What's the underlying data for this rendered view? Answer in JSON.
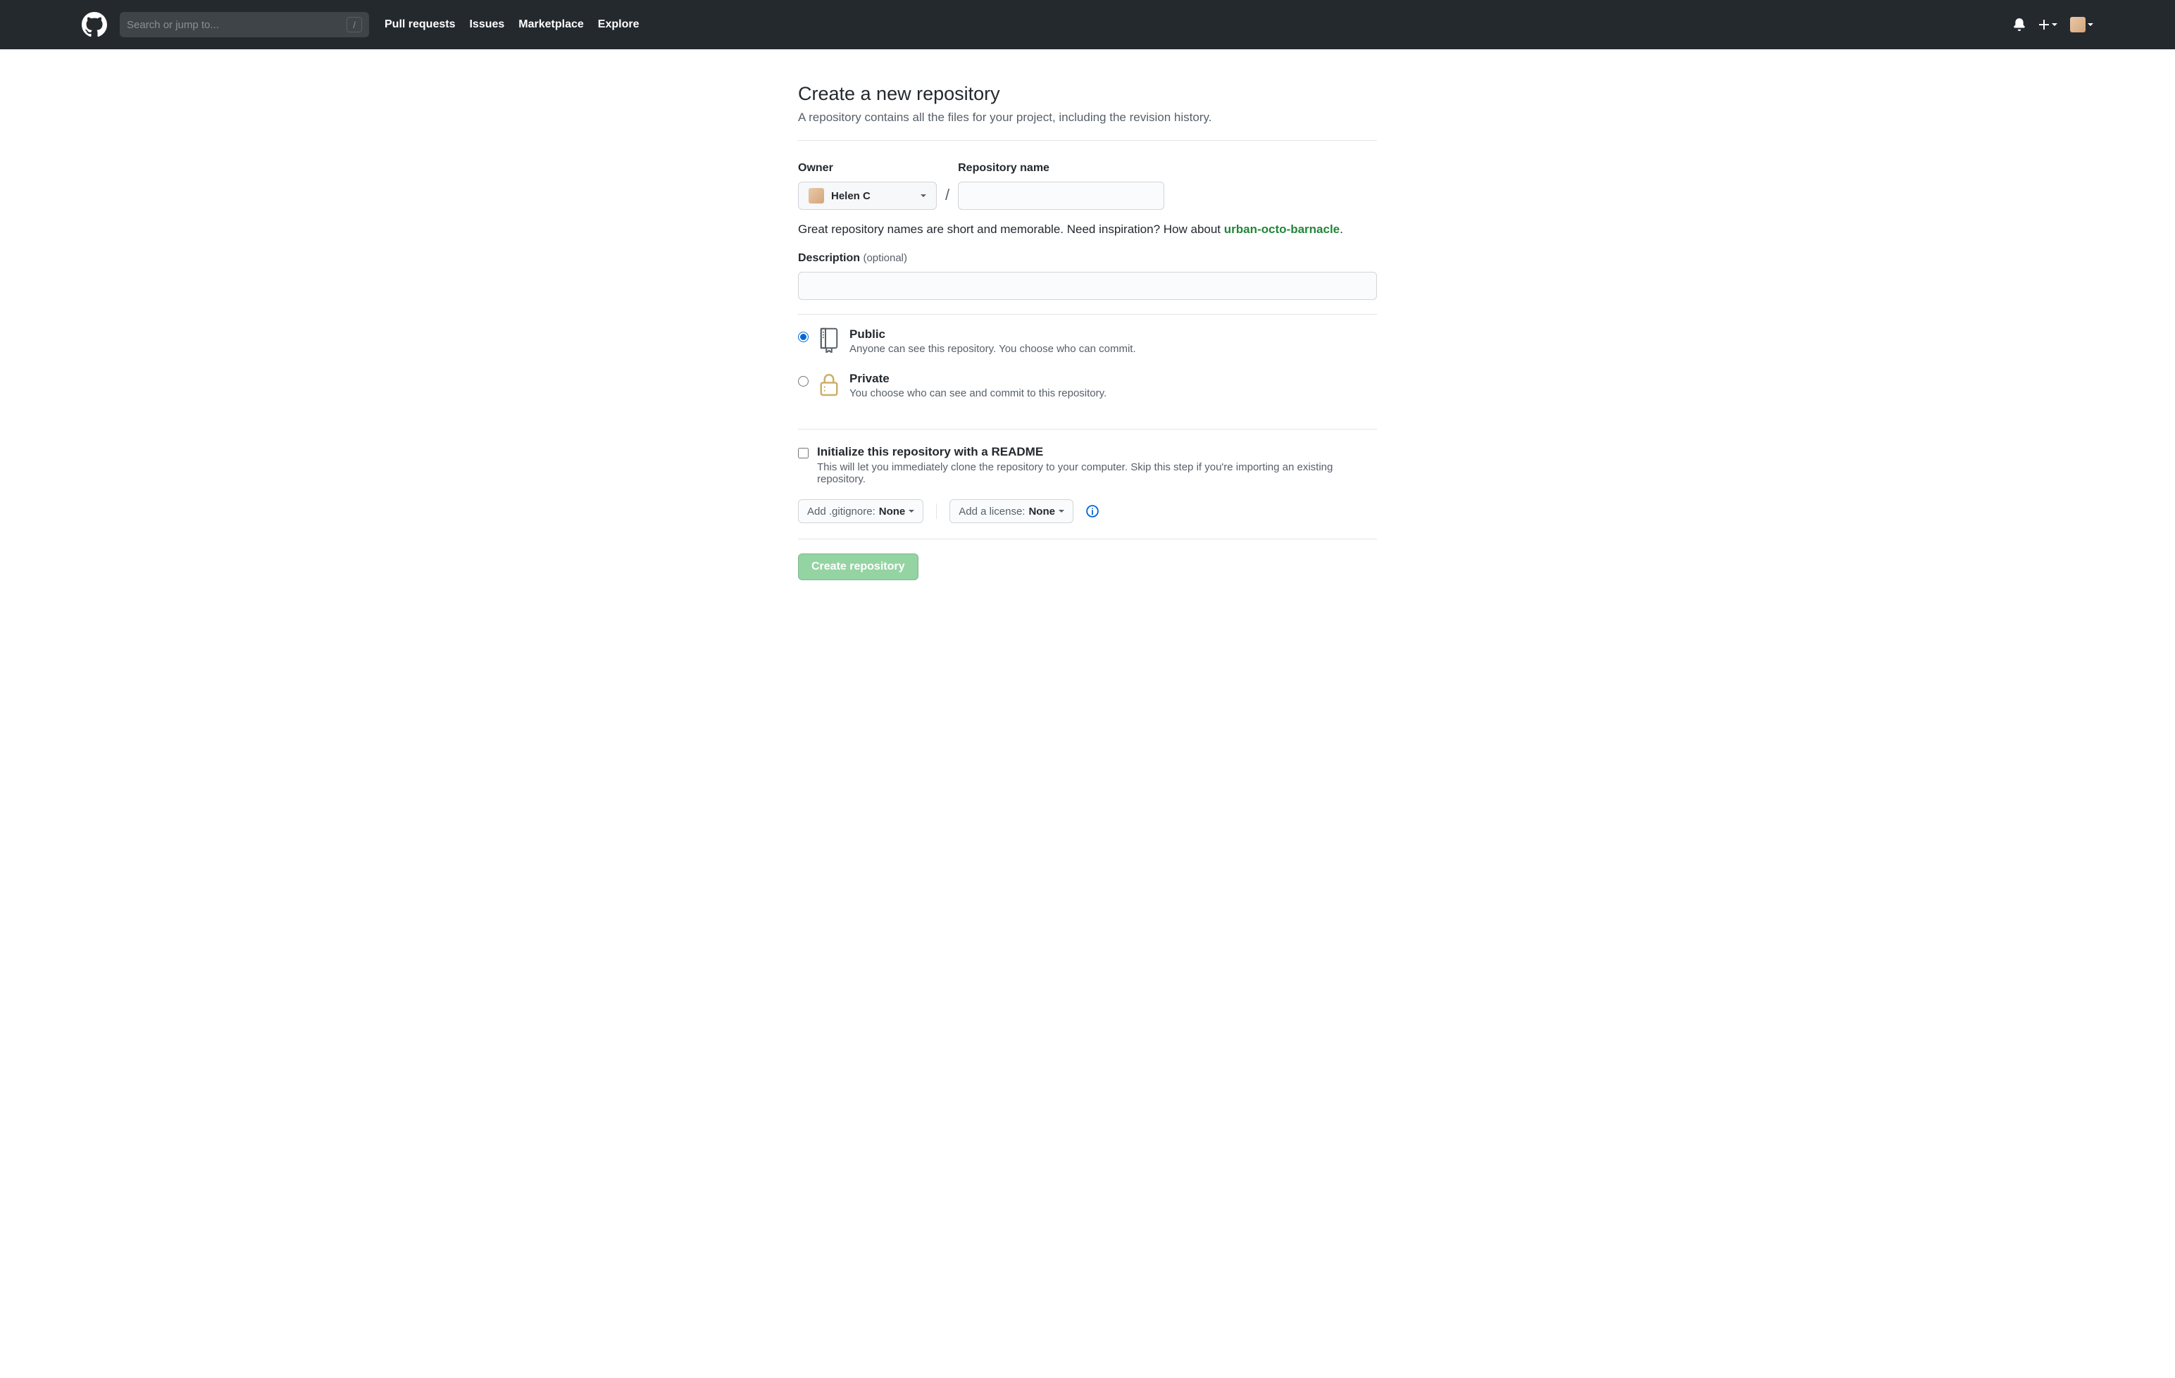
{
  "header": {
    "search_placeholder": "Search or jump to...",
    "slash_key": "/",
    "nav": [
      "Pull requests",
      "Issues",
      "Marketplace",
      "Explore"
    ]
  },
  "page": {
    "title": "Create a new repository",
    "subtitle": "A repository contains all the files for your project, including the revision history."
  },
  "form": {
    "owner_label": "Owner",
    "owner_value": "Helen C",
    "repo_label": "Repository name",
    "hint_prefix": "Great repository names are short and memorable. Need inspiration? How about ",
    "hint_suggestion": "urban-octo-barnacle",
    "hint_suffix": ".",
    "desc_label": "Description",
    "desc_optional": "(optional)",
    "visibility": {
      "public": {
        "title": "Public",
        "desc": "Anyone can see this repository. You choose who can commit."
      },
      "private": {
        "title": "Private",
        "desc": "You choose who can see and commit to this repository."
      }
    },
    "init": {
      "title": "Initialize this repository with a README",
      "desc": "This will let you immediately clone the repository to your computer. Skip this step if you're importing an existing repository."
    },
    "gitignore_prefix": "Add .gitignore: ",
    "gitignore_value": "None",
    "license_prefix": "Add a license: ",
    "license_value": "None",
    "submit": "Create repository"
  }
}
